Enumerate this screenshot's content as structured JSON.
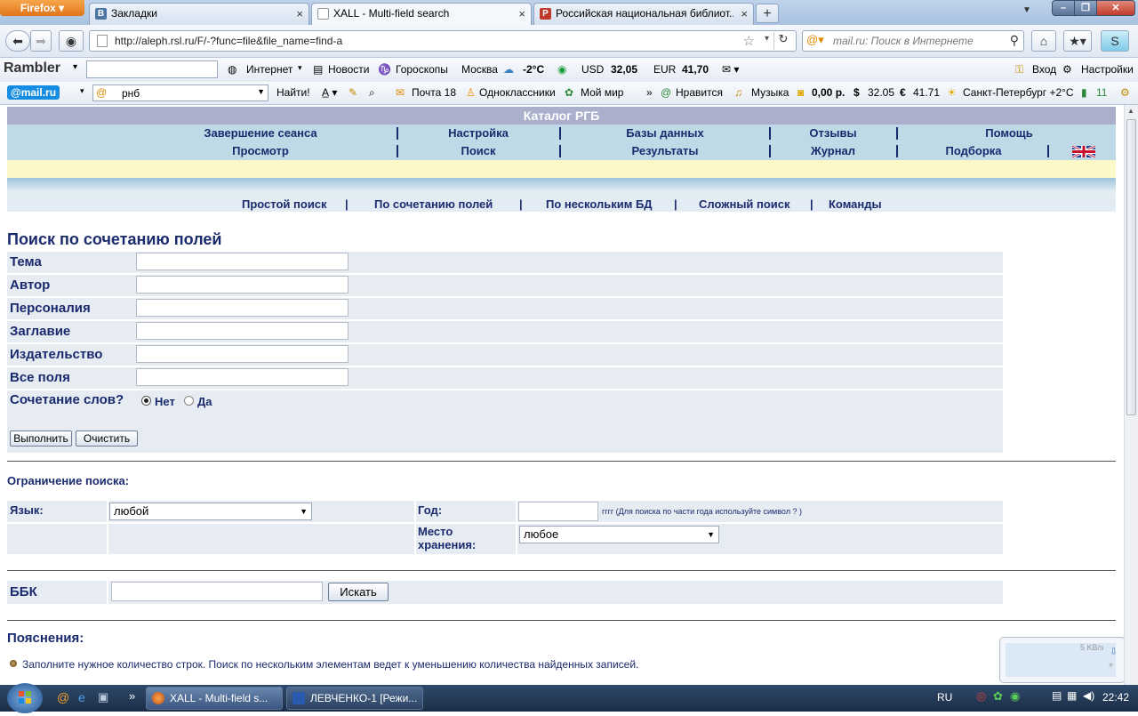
{
  "browser": {
    "menu_button": "Firefox",
    "tabs": [
      {
        "label": "Закладки",
        "icon": "vk-icon",
        "active": false
      },
      {
        "label": "XALL - Multi-field search",
        "icon": "page-icon",
        "active": true
      },
      {
        "label": "Российская национальная библиот...",
        "icon": "rnb-icon",
        "active": false
      }
    ],
    "new_tab": "+",
    "url": "http://aleph.rsl.ru/F/-?func=file&file_name=find-a",
    "search_placeholder": "mail.ru: Поиск в Интернете"
  },
  "rambler_bar": {
    "logo": "Rambler",
    "internet": "Интернет",
    "news": "Новости",
    "horoscopes": "Гороскопы",
    "city": "Москва",
    "temp": "-2°C",
    "usd_label": "USD",
    "usd_value": "32,05",
    "eur_label": "EUR",
    "eur_value": "41,70",
    "login": "Вход",
    "settings": "Настройки"
  },
  "mail_bar": {
    "logo": "@mail.ru",
    "search_value": "рнб",
    "find": "Найти!",
    "mail": "Почта 18",
    "ok": "Одноклассники",
    "myworld": "Мой мир",
    "like": "Нравится",
    "music": "Музыка",
    "balance": "0,00 р.",
    "usd": "32.05",
    "eur": "41.71",
    "weather": "Санкт-Петербург +2°C",
    "count": "11"
  },
  "catalog": {
    "title": "Каталог РГБ",
    "row1": [
      "Завершение сеанса",
      "Настройка",
      "Базы данных",
      "Отзывы",
      "Помощь"
    ],
    "row2": [
      "Просмотр",
      "Поиск",
      "Результаты",
      "Журнал",
      "Подборка"
    ],
    "subtabs": [
      "Простой поиск",
      "По сочетанию полей",
      "По нескольким БД",
      "Сложный поиск",
      "Команды"
    ]
  },
  "form": {
    "title": "Поиск по сочетанию полей",
    "fields": [
      "Тема",
      "Автор",
      "Персоналия",
      "Заглавие",
      "Издательство",
      "Все поля"
    ],
    "combine_label": "Сочетание слов?",
    "radio_no": "Нет",
    "radio_yes": "Да",
    "submit": "Выполнить",
    "clear": "Очистить"
  },
  "limits": {
    "title": "Ограничение поиска:",
    "language_label": "Язык:",
    "language_value": "любой",
    "year_label": "Год:",
    "year_hint": "гггг (Для поиска по части года используйте символ ? )",
    "location_label": "Место хранения:",
    "location_value": "любое"
  },
  "bbk": {
    "label": "ББК",
    "button": "Искать"
  },
  "notes": {
    "title": "Пояснения:",
    "items": [
      "Заполните нужное количество строк. Поиск по нескольким элементам ведет к уменьшению количества найденных записей."
    ]
  },
  "download_widget": {
    "speed": "5 KB/s"
  },
  "taskbar": {
    "windows": [
      "XALL - Multi-field s...",
      "ЛЕВЧЕНКО-1 [Режи..."
    ],
    "language": "RU",
    "time": "22:42"
  },
  "colors": {
    "accent": "#1a2a6e",
    "header_bg": "#aab0cc",
    "row_bg": "#e7ecf2"
  }
}
